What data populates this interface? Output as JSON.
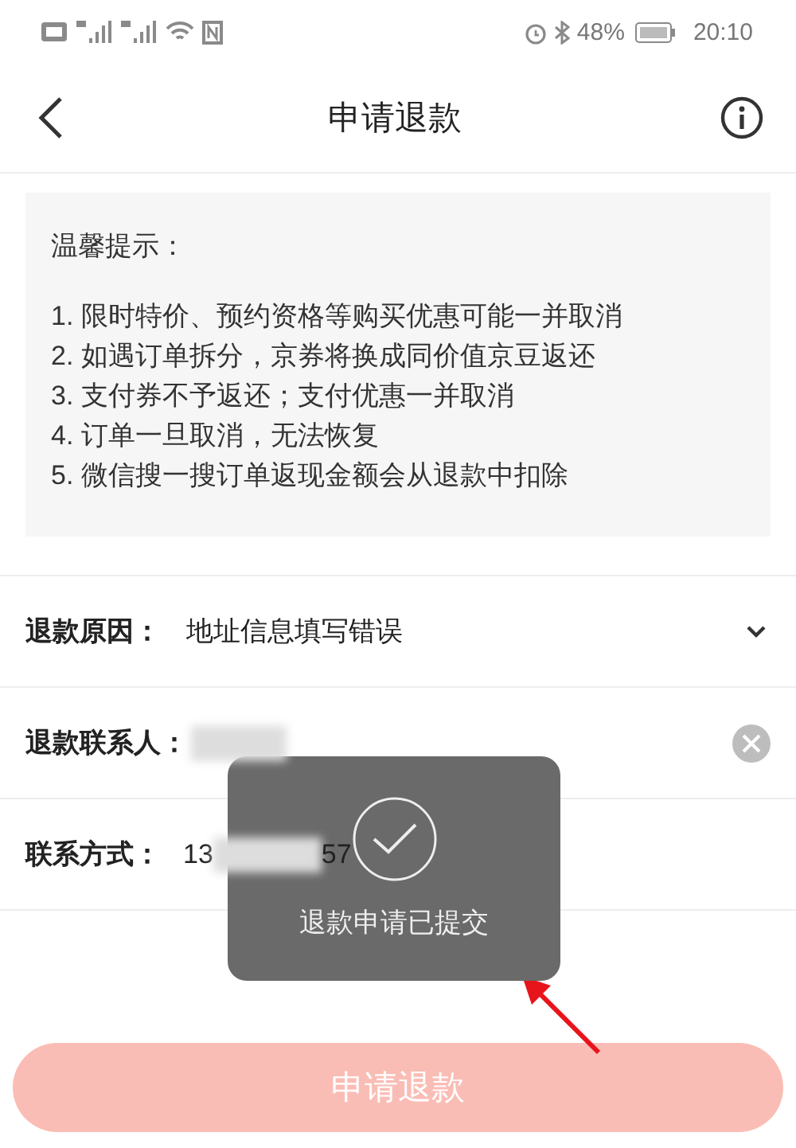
{
  "status_bar": {
    "battery": "48%",
    "time": "20:10"
  },
  "header": {
    "title": "申请退款"
  },
  "tips": {
    "title": "温馨提示：",
    "items": [
      "1. 限时特价、预约资格等购买优惠可能一并取消",
      "2. 如遇订单拆分，京券将换成同价值京豆返还",
      "3. 支付券不予返还；支付优惠一并取消",
      "4. 订单一旦取消，无法恢复",
      "5. 微信搜一搜订单返现金额会从退款中扣除"
    ]
  },
  "form": [
    {
      "kind": "select",
      "label": "退款原因：",
      "value": "地址信息填写错误"
    },
    {
      "kind": "blurred",
      "label": "退款联系人："
    },
    {
      "kind": "phone",
      "label": "联系方式：",
      "value_start": "13",
      "value_end": "57"
    }
  ],
  "submit_button": {
    "label": "申请退款",
    "disabled": true
  },
  "toast": {
    "message": "退款申请已提交"
  }
}
